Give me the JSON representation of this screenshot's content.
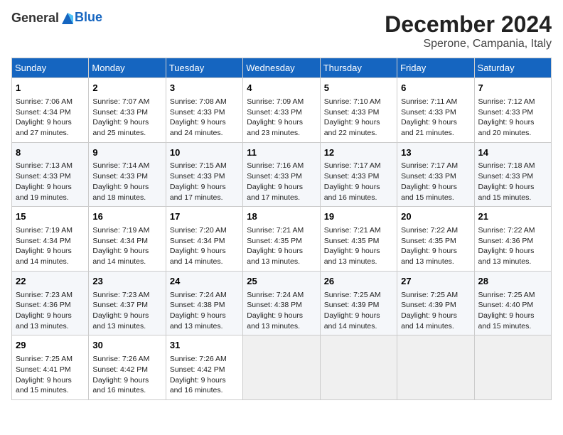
{
  "header": {
    "logo_line1": "General",
    "logo_line2": "Blue",
    "title": "December 2024",
    "subtitle": "Sperone, Campania, Italy"
  },
  "weekdays": [
    "Sunday",
    "Monday",
    "Tuesday",
    "Wednesday",
    "Thursday",
    "Friday",
    "Saturday"
  ],
  "weeks": [
    [
      {
        "day": "1",
        "sunrise": "Sunrise: 7:06 AM",
        "sunset": "Sunset: 4:34 PM",
        "daylight": "Daylight: 9 hours and 27 minutes."
      },
      {
        "day": "2",
        "sunrise": "Sunrise: 7:07 AM",
        "sunset": "Sunset: 4:33 PM",
        "daylight": "Daylight: 9 hours and 25 minutes."
      },
      {
        "day": "3",
        "sunrise": "Sunrise: 7:08 AM",
        "sunset": "Sunset: 4:33 PM",
        "daylight": "Daylight: 9 hours and 24 minutes."
      },
      {
        "day": "4",
        "sunrise": "Sunrise: 7:09 AM",
        "sunset": "Sunset: 4:33 PM",
        "daylight": "Daylight: 9 hours and 23 minutes."
      },
      {
        "day": "5",
        "sunrise": "Sunrise: 7:10 AM",
        "sunset": "Sunset: 4:33 PM",
        "daylight": "Daylight: 9 hours and 22 minutes."
      },
      {
        "day": "6",
        "sunrise": "Sunrise: 7:11 AM",
        "sunset": "Sunset: 4:33 PM",
        "daylight": "Daylight: 9 hours and 21 minutes."
      },
      {
        "day": "7",
        "sunrise": "Sunrise: 7:12 AM",
        "sunset": "Sunset: 4:33 PM",
        "daylight": "Daylight: 9 hours and 20 minutes."
      }
    ],
    [
      {
        "day": "8",
        "sunrise": "Sunrise: 7:13 AM",
        "sunset": "Sunset: 4:33 PM",
        "daylight": "Daylight: 9 hours and 19 minutes."
      },
      {
        "day": "9",
        "sunrise": "Sunrise: 7:14 AM",
        "sunset": "Sunset: 4:33 PM",
        "daylight": "Daylight: 9 hours and 18 minutes."
      },
      {
        "day": "10",
        "sunrise": "Sunrise: 7:15 AM",
        "sunset": "Sunset: 4:33 PM",
        "daylight": "Daylight: 9 hours and 17 minutes."
      },
      {
        "day": "11",
        "sunrise": "Sunrise: 7:16 AM",
        "sunset": "Sunset: 4:33 PM",
        "daylight": "Daylight: 9 hours and 17 minutes."
      },
      {
        "day": "12",
        "sunrise": "Sunrise: 7:17 AM",
        "sunset": "Sunset: 4:33 PM",
        "daylight": "Daylight: 9 hours and 16 minutes."
      },
      {
        "day": "13",
        "sunrise": "Sunrise: 7:17 AM",
        "sunset": "Sunset: 4:33 PM",
        "daylight": "Daylight: 9 hours and 15 minutes."
      },
      {
        "day": "14",
        "sunrise": "Sunrise: 7:18 AM",
        "sunset": "Sunset: 4:33 PM",
        "daylight": "Daylight: 9 hours and 15 minutes."
      }
    ],
    [
      {
        "day": "15",
        "sunrise": "Sunrise: 7:19 AM",
        "sunset": "Sunset: 4:34 PM",
        "daylight": "Daylight: 9 hours and 14 minutes."
      },
      {
        "day": "16",
        "sunrise": "Sunrise: 7:19 AM",
        "sunset": "Sunset: 4:34 PM",
        "daylight": "Daylight: 9 hours and 14 minutes."
      },
      {
        "day": "17",
        "sunrise": "Sunrise: 7:20 AM",
        "sunset": "Sunset: 4:34 PM",
        "daylight": "Daylight: 9 hours and 14 minutes."
      },
      {
        "day": "18",
        "sunrise": "Sunrise: 7:21 AM",
        "sunset": "Sunset: 4:35 PM",
        "daylight": "Daylight: 9 hours and 13 minutes."
      },
      {
        "day": "19",
        "sunrise": "Sunrise: 7:21 AM",
        "sunset": "Sunset: 4:35 PM",
        "daylight": "Daylight: 9 hours and 13 minutes."
      },
      {
        "day": "20",
        "sunrise": "Sunrise: 7:22 AM",
        "sunset": "Sunset: 4:35 PM",
        "daylight": "Daylight: 9 hours and 13 minutes."
      },
      {
        "day": "21",
        "sunrise": "Sunrise: 7:22 AM",
        "sunset": "Sunset: 4:36 PM",
        "daylight": "Daylight: 9 hours and 13 minutes."
      }
    ],
    [
      {
        "day": "22",
        "sunrise": "Sunrise: 7:23 AM",
        "sunset": "Sunset: 4:36 PM",
        "daylight": "Daylight: 9 hours and 13 minutes."
      },
      {
        "day": "23",
        "sunrise": "Sunrise: 7:23 AM",
        "sunset": "Sunset: 4:37 PM",
        "daylight": "Daylight: 9 hours and 13 minutes."
      },
      {
        "day": "24",
        "sunrise": "Sunrise: 7:24 AM",
        "sunset": "Sunset: 4:38 PM",
        "daylight": "Daylight: 9 hours and 13 minutes."
      },
      {
        "day": "25",
        "sunrise": "Sunrise: 7:24 AM",
        "sunset": "Sunset: 4:38 PM",
        "daylight": "Daylight: 9 hours and 13 minutes."
      },
      {
        "day": "26",
        "sunrise": "Sunrise: 7:25 AM",
        "sunset": "Sunset: 4:39 PM",
        "daylight": "Daylight: 9 hours and 14 minutes."
      },
      {
        "day": "27",
        "sunrise": "Sunrise: 7:25 AM",
        "sunset": "Sunset: 4:39 PM",
        "daylight": "Daylight: 9 hours and 14 minutes."
      },
      {
        "day": "28",
        "sunrise": "Sunrise: 7:25 AM",
        "sunset": "Sunset: 4:40 PM",
        "daylight": "Daylight: 9 hours and 15 minutes."
      }
    ],
    [
      {
        "day": "29",
        "sunrise": "Sunrise: 7:25 AM",
        "sunset": "Sunset: 4:41 PM",
        "daylight": "Daylight: 9 hours and 15 minutes."
      },
      {
        "day": "30",
        "sunrise": "Sunrise: 7:26 AM",
        "sunset": "Sunset: 4:42 PM",
        "daylight": "Daylight: 9 hours and 16 minutes."
      },
      {
        "day": "31",
        "sunrise": "Sunrise: 7:26 AM",
        "sunset": "Sunset: 4:42 PM",
        "daylight": "Daylight: 9 hours and 16 minutes."
      },
      null,
      null,
      null,
      null
    ]
  ]
}
